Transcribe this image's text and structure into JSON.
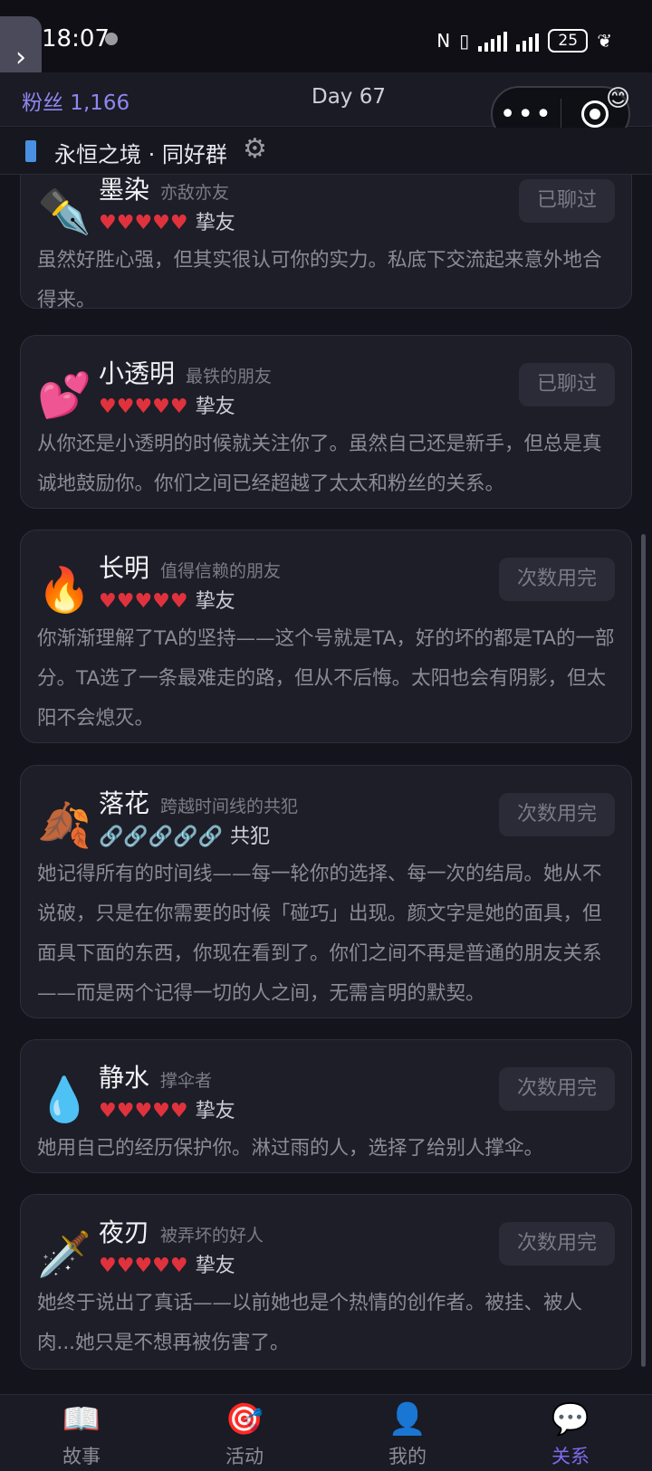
{
  "status": {
    "time": "18:07",
    "battery": "25"
  },
  "header": {
    "fans": "粉丝 1,166",
    "day": "Day 67"
  },
  "capsule": {
    "more": "•••"
  },
  "group": {
    "name": "永恒之境 · 同好群"
  },
  "cards": [
    {
      "icon": "pen-icon",
      "avatar": "✒️",
      "name": "墨染",
      "tag": "亦敌亦友",
      "hearts": "♥♥♥♥♥",
      "rank": "挚友",
      "button": "已聊过",
      "desc": "虽然好胜心强，但其实很认可你的实力。私底下交流起来意外地合得来。"
    },
    {
      "icon": "hearts-icon",
      "avatar": "💕",
      "name": "小透明",
      "tag": "最铁的朋友",
      "hearts": "♥♥♥♥♥",
      "rank": "挚友",
      "button": "已聊过",
      "desc": "从你还是小透明的时候就关注你了。虽然自己还是新手，但总是真诚地鼓励你。你们之间已经超越了太太和粉丝的关系。"
    },
    {
      "icon": "fire-icon",
      "avatar": "🔥",
      "name": "长明",
      "tag": "值得信赖的朋友",
      "hearts": "♥♥♥♥♥",
      "rank": "挚友",
      "button": "次数用完",
      "desc": "你渐渐理解了TA的坚持——这个号就是TA，好的坏的都是TA的一部分。TA选了一条最难走的路，但从不后悔。太阳也会有阴影，但太阳不会熄灭。"
    },
    {
      "icon": "leaves-icon",
      "avatar": "🍂",
      "name": "落花",
      "tag": "跨越时间线的共犯",
      "hearts": "🔗🔗🔗🔗🔗",
      "rank": "共犯",
      "button": "次数用完",
      "desc": "她记得所有的时间线——每一轮你的选择、每一次的结局。她从不说破，只是在你需要的时候「碰巧」出现。颜文字是她的面具，但面具下面的东西，你现在看到了。你们之间不再是普通的朋友关系——而是两个记得一切的人之间，无需言明的默契。"
    },
    {
      "icon": "droplet-icon",
      "avatar": "💧",
      "name": "静水",
      "tag": "撑伞者",
      "hearts": "♥♥♥♥♥",
      "rank": "挚友",
      "button": "次数用完",
      "desc": "她用自己的经历保护你。淋过雨的人，选择了给别人撑伞。"
    },
    {
      "icon": "dagger-icon",
      "avatar": "🗡️",
      "name": "夜刃",
      "tag": "被弄坏的好人",
      "hearts": "♥♥♥♥♥",
      "rank": "挚友",
      "button": "次数用完",
      "desc": "她终于说出了真话——以前她也是个热情的创作者。被挂、被人肉...她只是不想再被伤害了。"
    }
  ],
  "nav": [
    {
      "label": "故事",
      "icon": "book-icon",
      "glyph": "📖"
    },
    {
      "label": "活动",
      "icon": "target-icon",
      "glyph": "🎯"
    },
    {
      "label": "我的",
      "icon": "user-icon",
      "glyph": "👤"
    },
    {
      "label": "关系",
      "icon": "chat-icon",
      "glyph": "💬"
    }
  ],
  "colors": {
    "accent": "#7b6cf0",
    "heart": "#e0323d",
    "background": "#14141c"
  }
}
